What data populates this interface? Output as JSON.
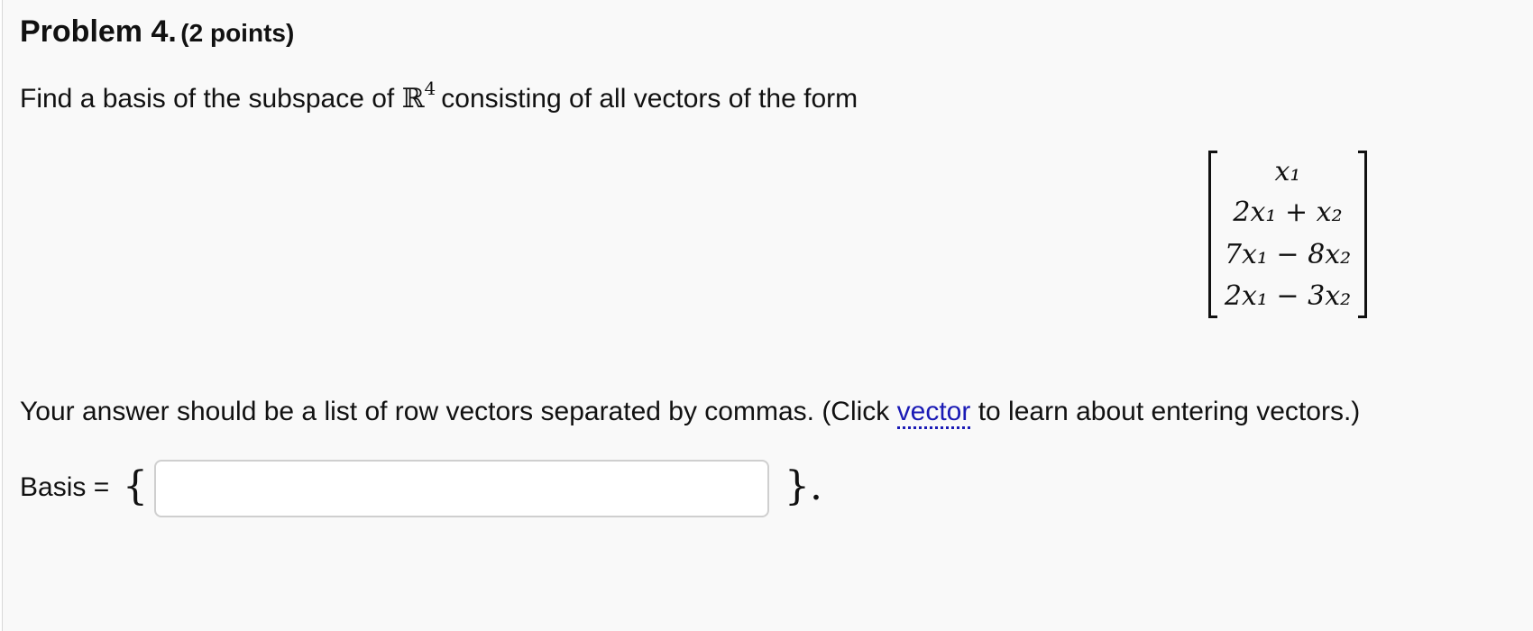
{
  "problem": {
    "title": "Problem 4.",
    "points": "(2 points)",
    "statement_before": "Find a basis of the subspace of ",
    "space_symbol": "ℝ",
    "space_exponent": "4",
    "statement_after": "consisting of all vectors of the form",
    "vector_entries": [
      "x₁",
      "2x₁ + x₂",
      "7x₁ − 8x₂",
      "2x₁ − 3x₂"
    ]
  },
  "instruction": {
    "before_link": "Your answer should be a list of row vectors separated by commas. (Click ",
    "link_text": "vector",
    "after_link": " to learn about entering vectors.)"
  },
  "answer": {
    "label": "Basis = ",
    "open_brace": "{",
    "close_brace": "}.",
    "value": "",
    "placeholder": ""
  }
}
